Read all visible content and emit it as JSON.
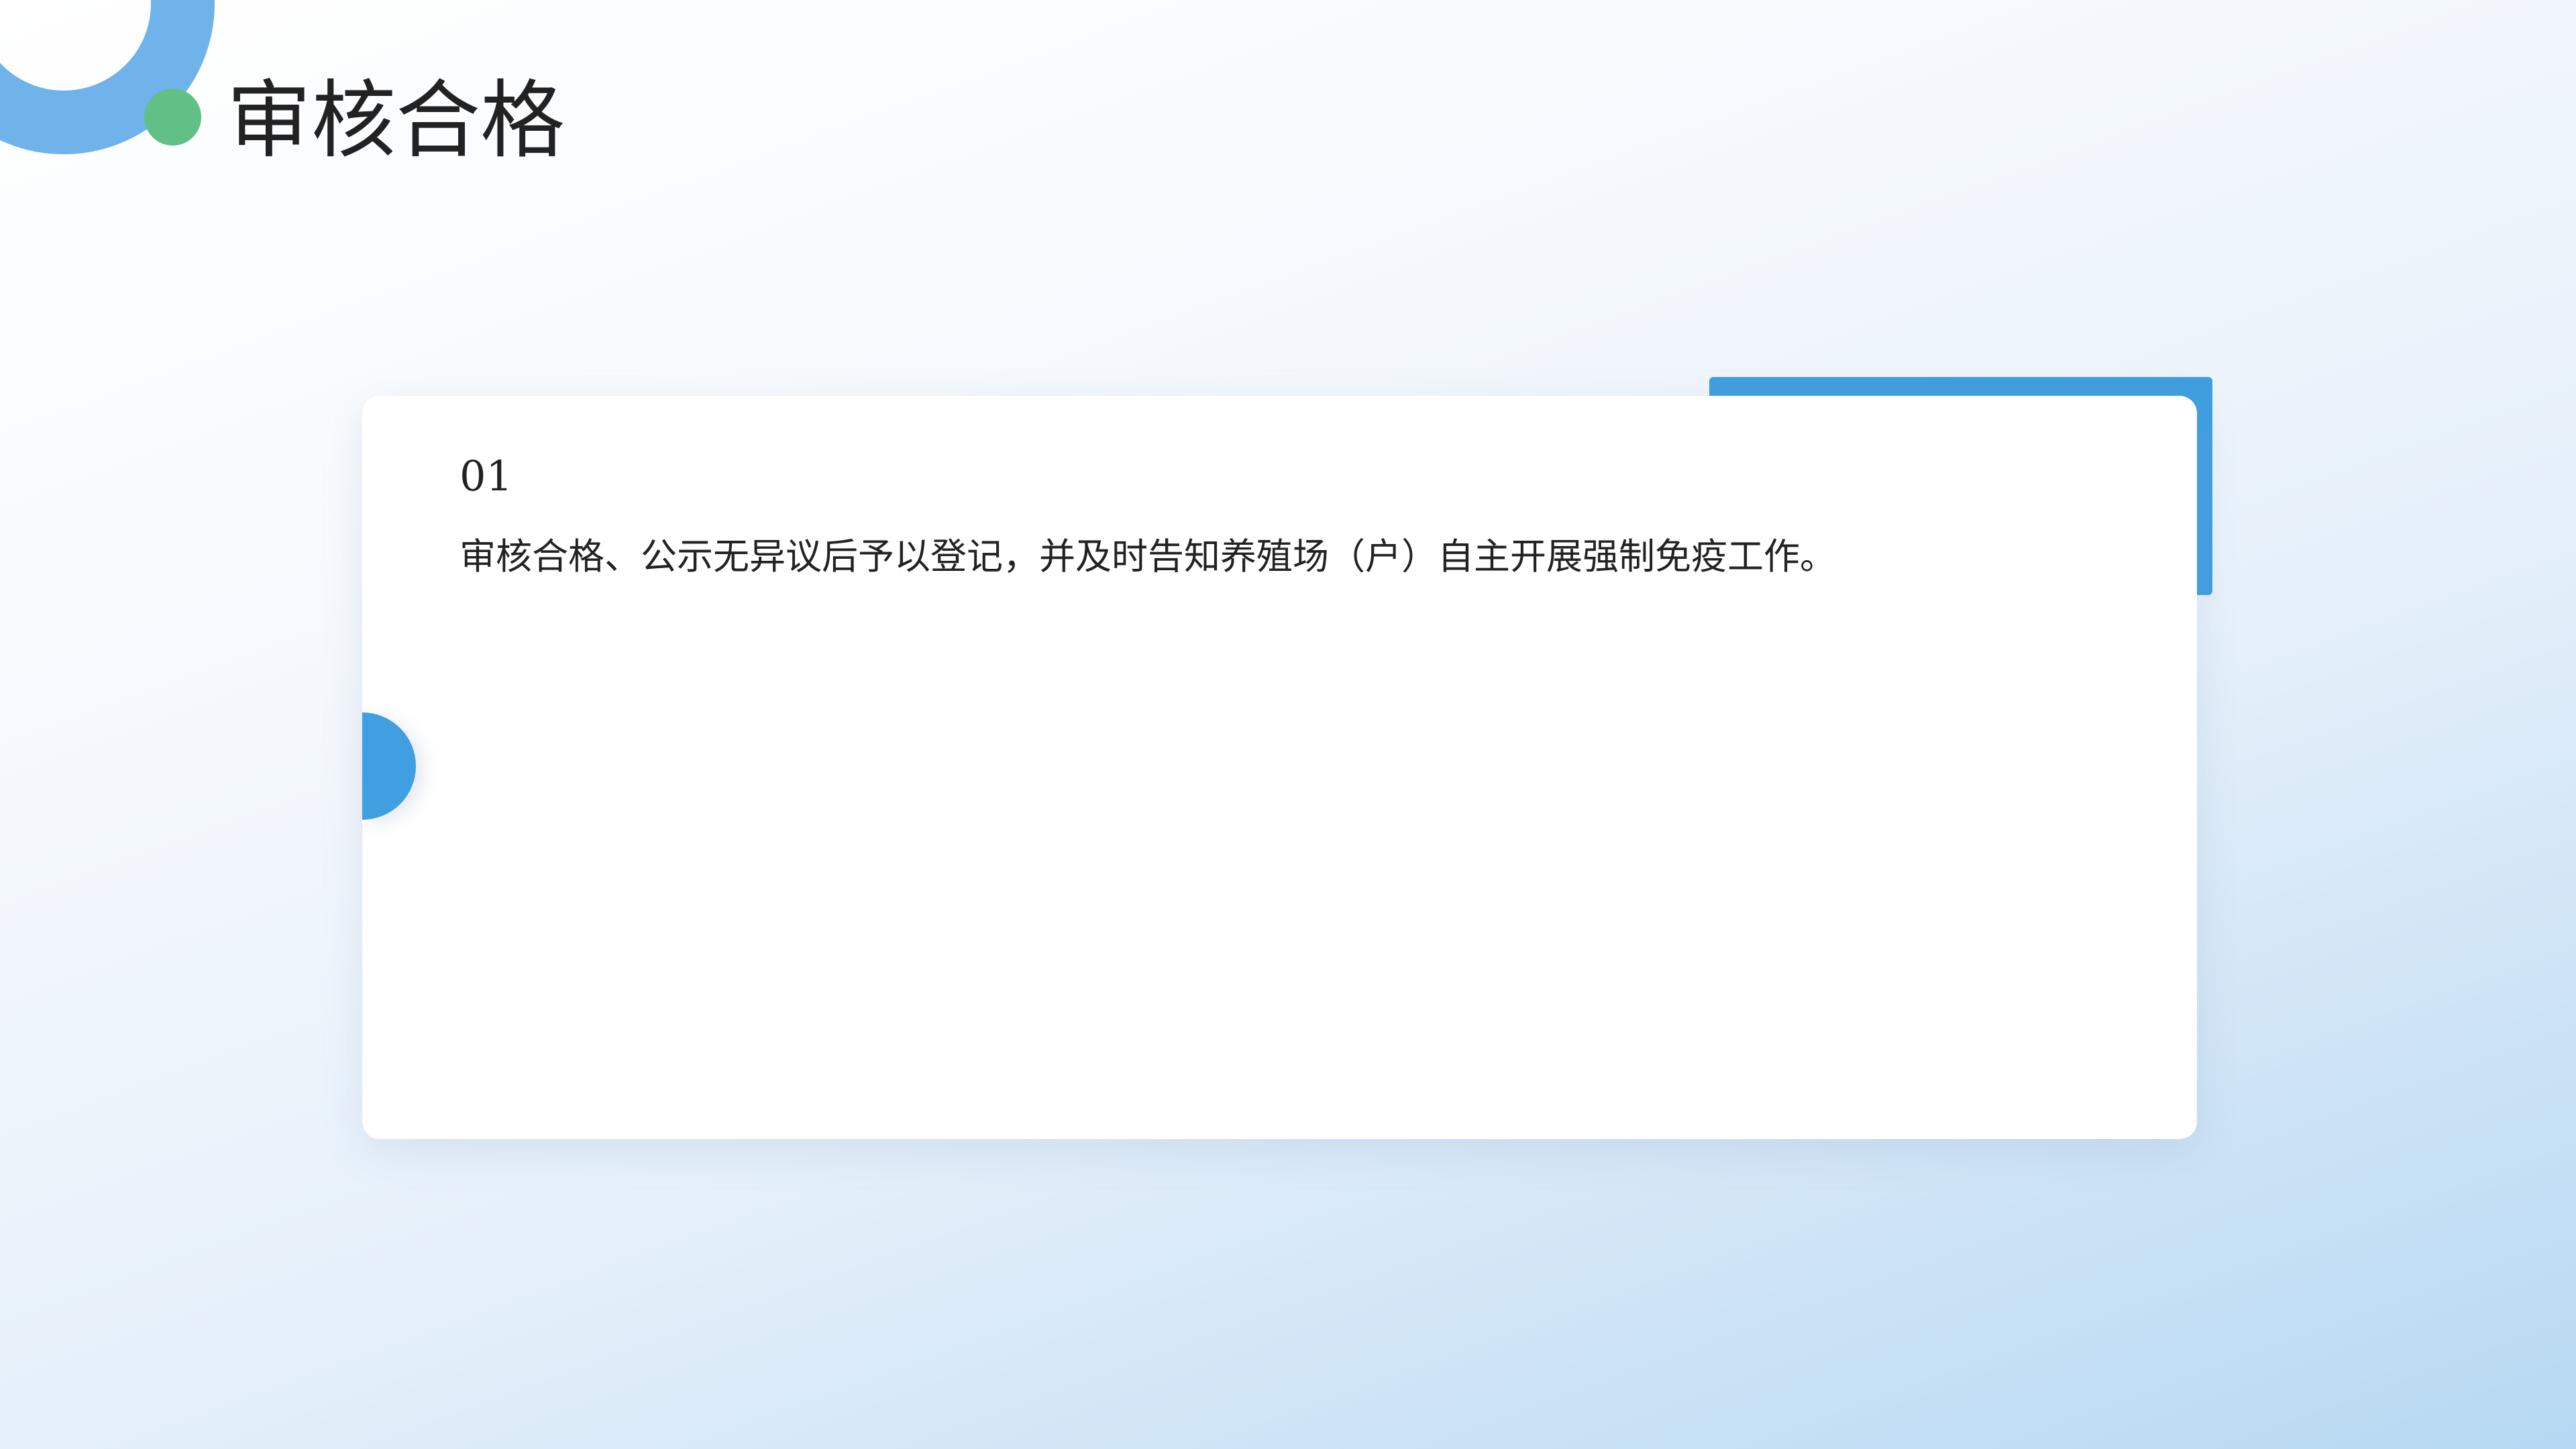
{
  "page": {
    "title": "审核合格"
  },
  "card": {
    "number": "01",
    "text": "审核合格、公示无异议后予以登记，并及时告知养殖场（户）自主开展强制免疫工作。"
  },
  "colors": {
    "accent_blue": "#3f9fe0",
    "dot_green": "#62bf86",
    "ring_blue": "#6fb3ea"
  }
}
